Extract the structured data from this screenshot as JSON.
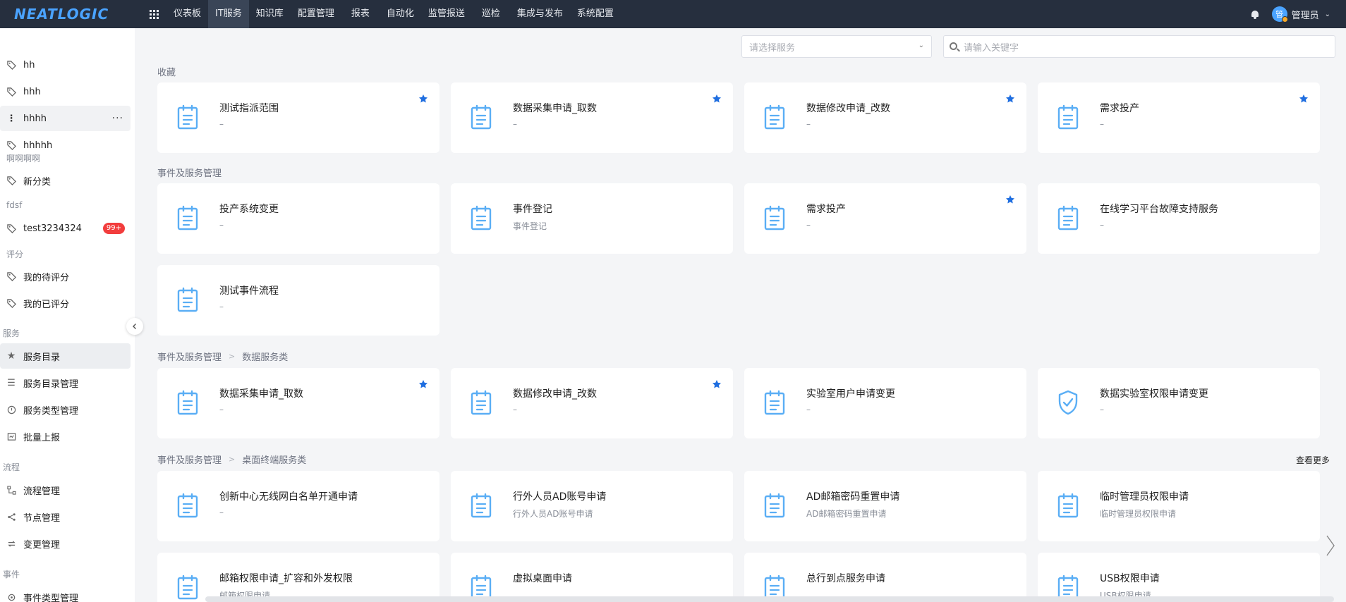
{
  "topbar": {
    "logo": "NEATLOGIC",
    "nav": [
      "仪表板",
      "IT服务",
      "知识库",
      "配置管理",
      "报表",
      "自动化",
      "监管报送",
      "巡检",
      "集成与发布",
      "系统配置"
    ],
    "active_nav": "IT服务",
    "user_initial": "管",
    "user_name": "管理员"
  },
  "sidebar": {
    "items": [
      {
        "label": "hh"
      },
      {
        "label": "hhh"
      },
      {
        "label": "hhhh",
        "more": "···"
      },
      {
        "label": "hhhhh"
      },
      {
        "group": "啊啊啊啊"
      },
      {
        "label": "新分类"
      },
      {
        "group": "fdsf"
      },
      {
        "label": "test3234324",
        "badge": "99+"
      },
      {
        "group": "评分"
      },
      {
        "label": "我的待评分"
      },
      {
        "label": "我的已评分"
      },
      {
        "section": "服务"
      },
      {
        "label": "服务目录"
      },
      {
        "label": "服务目录管理"
      },
      {
        "label": "服务类型管理"
      },
      {
        "label": "批量上报"
      },
      {
        "section": "流程"
      },
      {
        "label": "流程管理"
      },
      {
        "label": "节点管理"
      },
      {
        "label": "变更管理"
      },
      {
        "section": "事件"
      },
      {
        "label": "事件类型管理"
      }
    ]
  },
  "filters": {
    "service_placeholder": "请选择服务",
    "search_placeholder": "请输入关键字"
  },
  "sections": {
    "favorites": {
      "title": "收藏"
    },
    "incident": {
      "title": "事件及服务管理"
    },
    "data": {
      "crumb1": "事件及服务管理",
      "crumb2": "数据服务类"
    },
    "desktop": {
      "crumb1": "事件及服务管理",
      "crumb2": "桌面终端服务类",
      "see_more": "查看更多"
    }
  },
  "cards": {
    "fav": [
      {
        "title": "测试指派范围",
        "desc": "–",
        "starred": true
      },
      {
        "title": "数据采集申请_取数",
        "desc": "–",
        "starred": true
      },
      {
        "title": "数据修改申请_改数",
        "desc": "–",
        "starred": true
      },
      {
        "title": "需求投产",
        "desc": "–",
        "starred": true
      }
    ],
    "incident": [
      {
        "title": "投产系统变更",
        "desc": "–",
        "starred": false
      },
      {
        "title": "事件登记",
        "desc": "事件登记",
        "starred": false
      },
      {
        "title": "需求投产",
        "desc": "–",
        "starred": true
      },
      {
        "title": "在线学习平台故障支持服务",
        "desc": "–",
        "starred": false
      },
      {
        "title": "测试事件流程",
        "desc": "–",
        "starred": false
      }
    ],
    "data": [
      {
        "title": "数据采集申请_取数",
        "desc": "–",
        "starred": true
      },
      {
        "title": "数据修改申请_改数",
        "desc": "–",
        "starred": true
      },
      {
        "title": "实验室用户申请变更",
        "desc": "–",
        "starred": false
      },
      {
        "title": "数据实验室权限申请变更",
        "desc": "–",
        "starred": false,
        "icon": "shield"
      }
    ],
    "desktop": [
      {
        "title": "创新中心无线网白名单开通申请",
        "desc": "–",
        "starred": false
      },
      {
        "title": "行外人员AD账号申请",
        "desc": "行外人员AD账号申请",
        "starred": false
      },
      {
        "title": "AD邮箱密码重置申请",
        "desc": "AD邮箱密码重置申请",
        "starred": false
      },
      {
        "title": "临时管理员权限申请",
        "desc": "临时管理员权限申请",
        "starred": false
      },
      {
        "title": "邮箱权限申请_扩容和外发权限",
        "desc": "邮箱权限申请",
        "starred": false
      },
      {
        "title": "虚拟桌面申请",
        "desc": "",
        "starred": false
      },
      {
        "title": "总行到点服务申请",
        "desc": "",
        "starred": false
      },
      {
        "title": "USB权限申请",
        "desc": "USB权限申请",
        "starred": false
      }
    ]
  },
  "colors": {
    "accent": "#4aa3ff",
    "star": "#1f6ee0",
    "topbar": "#262f3e",
    "badge": "#f23d3d"
  }
}
